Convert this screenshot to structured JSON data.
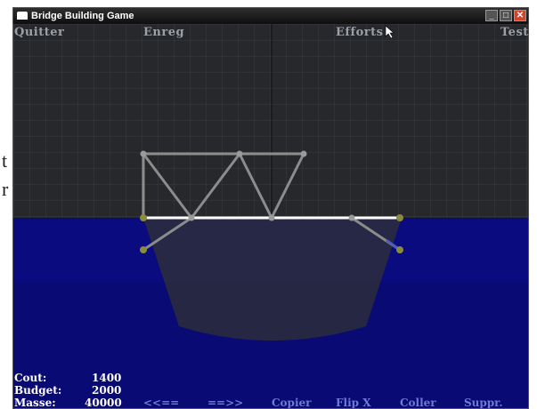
{
  "window": {
    "title": "Bridge Building Game"
  },
  "background": {
    "glyph_top": "t",
    "glyph_bottom": "r"
  },
  "menu": {
    "quit": "Quitter",
    "save": "Enreg",
    "efforts": "Efforts",
    "test": "Test"
  },
  "stats": {
    "cost_label": "Cout:",
    "cost_value": "1400",
    "budget_label": "Budget:",
    "budget_value": "2000",
    "mass_label": "Masse:",
    "mass_value": "40000"
  },
  "toolbar": {
    "undo": "<<==",
    "redo": "==>>",
    "copy": "Copier",
    "flip": "Flip X",
    "paste": "Coller",
    "delete": "Suppr."
  },
  "colors": {
    "sky": "#26282c",
    "water": "#0a0a78",
    "deck": "#ffffff",
    "beam": "#8c8c8c",
    "anchor": "#8a8a3a"
  }
}
